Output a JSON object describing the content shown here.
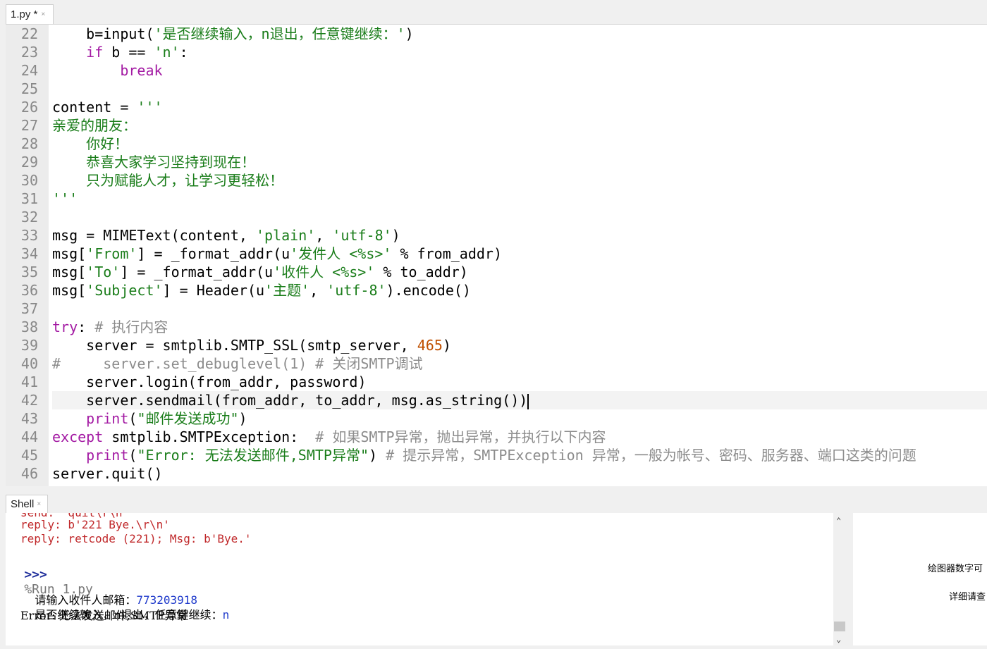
{
  "editor": {
    "tab_label": "1.py *",
    "tab_close": "×",
    "lines": [
      {
        "n": "22",
        "tokens": [
          {
            "t": "    b=input(",
            "c": ""
          },
          {
            "t": "'是否继续输入，n退出，任意键继续：'",
            "c": "s"
          },
          {
            "t": ")",
            "c": ""
          }
        ]
      },
      {
        "n": "23",
        "tokens": [
          {
            "t": "    ",
            "c": ""
          },
          {
            "t": "if",
            "c": "k"
          },
          {
            "t": " b == ",
            "c": ""
          },
          {
            "t": "'n'",
            "c": "s"
          },
          {
            "t": ":",
            "c": ""
          }
        ]
      },
      {
        "n": "24",
        "tokens": [
          {
            "t": "        ",
            "c": ""
          },
          {
            "t": "break",
            "c": "k"
          }
        ]
      },
      {
        "n": "25",
        "tokens": []
      },
      {
        "n": "26",
        "tokens": [
          {
            "t": "content = ",
            "c": ""
          },
          {
            "t": "'''",
            "c": "s"
          }
        ]
      },
      {
        "n": "27",
        "tokens": [
          {
            "t": "亲爱的朋友：",
            "c": "s"
          }
        ]
      },
      {
        "n": "28",
        "tokens": [
          {
            "t": "    你好！",
            "c": "s"
          }
        ]
      },
      {
        "n": "29",
        "tokens": [
          {
            "t": "    恭喜大家学习坚持到现在！",
            "c": "s"
          }
        ]
      },
      {
        "n": "30",
        "tokens": [
          {
            "t": "    只为赋能人才，让学习更轻松！",
            "c": "s"
          }
        ]
      },
      {
        "n": "31",
        "tokens": [
          {
            "t": "'''",
            "c": "s"
          }
        ]
      },
      {
        "n": "32",
        "tokens": []
      },
      {
        "n": "33",
        "tokens": [
          {
            "t": "msg = MIMEText(content, ",
            "c": ""
          },
          {
            "t": "'plain'",
            "c": "s"
          },
          {
            "t": ", ",
            "c": ""
          },
          {
            "t": "'utf-8'",
            "c": "s"
          },
          {
            "t": ")",
            "c": ""
          }
        ]
      },
      {
        "n": "34",
        "tokens": [
          {
            "t": "msg[",
            "c": ""
          },
          {
            "t": "'From'",
            "c": "s"
          },
          {
            "t": "] = _format_addr(u",
            "c": ""
          },
          {
            "t": "'发件人 <%s>'",
            "c": "s"
          },
          {
            "t": " % from_addr)",
            "c": ""
          }
        ]
      },
      {
        "n": "35",
        "tokens": [
          {
            "t": "msg[",
            "c": ""
          },
          {
            "t": "'To'",
            "c": "s"
          },
          {
            "t": "] = _format_addr(u",
            "c": ""
          },
          {
            "t": "'收件人 <%s>'",
            "c": "s"
          },
          {
            "t": " % to_addr)",
            "c": ""
          }
        ]
      },
      {
        "n": "36",
        "tokens": [
          {
            "t": "msg[",
            "c": ""
          },
          {
            "t": "'Subject'",
            "c": "s"
          },
          {
            "t": "] = Header(u",
            "c": ""
          },
          {
            "t": "'主题'",
            "c": "s"
          },
          {
            "t": ", ",
            "c": ""
          },
          {
            "t": "'utf-8'",
            "c": "s"
          },
          {
            "t": ").encode()",
            "c": ""
          }
        ]
      },
      {
        "n": "37",
        "tokens": []
      },
      {
        "n": "38",
        "tokens": [
          {
            "t": "try",
            "c": "k"
          },
          {
            "t": ": ",
            "c": ""
          },
          {
            "t": "# 执行内容",
            "c": "c"
          }
        ]
      },
      {
        "n": "39",
        "tokens": [
          {
            "t": "    server = smtplib.SMTP_SSL(smtp_server, ",
            "c": ""
          },
          {
            "t": "465",
            "c": "n"
          },
          {
            "t": ")",
            "c": ""
          }
        ]
      },
      {
        "n": "40",
        "tokens": [
          {
            "t": "#     server.set_debuglevel(1) # 关闭SMTP调试",
            "c": "c"
          }
        ]
      },
      {
        "n": "41",
        "tokens": [
          {
            "t": "    server.login(from_addr, password)",
            "c": ""
          }
        ]
      },
      {
        "n": "42",
        "cur": true,
        "tokens": [
          {
            "t": "    server.sendmail(from_addr, to_addr, msg.as_string())",
            "c": ""
          }
        ]
      },
      {
        "n": "43",
        "tokens": [
          {
            "t": "    ",
            "c": ""
          },
          {
            "t": "print",
            "c": "k"
          },
          {
            "t": "(",
            "c": ""
          },
          {
            "t": "\"邮件发送成功\"",
            "c": "s"
          },
          {
            "t": ")",
            "c": ""
          }
        ]
      },
      {
        "n": "44",
        "tokens": [
          {
            "t": "except",
            "c": "k"
          },
          {
            "t": " smtplib.SMTPException:  ",
            "c": ""
          },
          {
            "t": "# 如果SMTP异常，抛出异常，并执行以下内容",
            "c": "c"
          }
        ]
      },
      {
        "n": "45",
        "tokens": [
          {
            "t": "    ",
            "c": ""
          },
          {
            "t": "print",
            "c": "k"
          },
          {
            "t": "(",
            "c": ""
          },
          {
            "t": "\"Error: 无法发送邮件,SMTP异常\"",
            "c": "s"
          },
          {
            "t": ") ",
            "c": ""
          },
          {
            "t": "# 提示异常，SMTPException 异常，一般为帐号、密码、服务器、端口这类的问题",
            "c": "c"
          }
        ]
      },
      {
        "n": "46",
        "tokens": [
          {
            "t": "server.quit()",
            "c": ""
          }
        ]
      }
    ]
  },
  "shell": {
    "tab_label": "Shell",
    "tab_close": "×",
    "partial_line": "send: 'quit\\r\\n'",
    "reply1": "reply: b'221 Bye.\\r\\n'",
    "reply2": "reply: retcode (221); Msg: b'Bye.'",
    "prompt": ">>>",
    "run_cmd": "%Run 1.py",
    "out1_label": "请输入收件人邮箱：",
    "out1_value": "773203918",
    "out2_label": "是否继续输入，n退出，任意键继续：",
    "out2_value": "n",
    "out3": "Error: 无法发送邮件,SMTP异常",
    "prompt2": ">>>"
  },
  "side_panel": {
    "text1": "绘图器数字可",
    "text2": "详细请查"
  },
  "colors": {
    "keyword": "#9a1aa0",
    "string": "#1a7d1a",
    "comment": "#8c8c8c",
    "number": "#c05000",
    "shell_error": "#c0282a",
    "shell_prompt": "#1d2c9a",
    "shell_input": "#1f3acb"
  }
}
